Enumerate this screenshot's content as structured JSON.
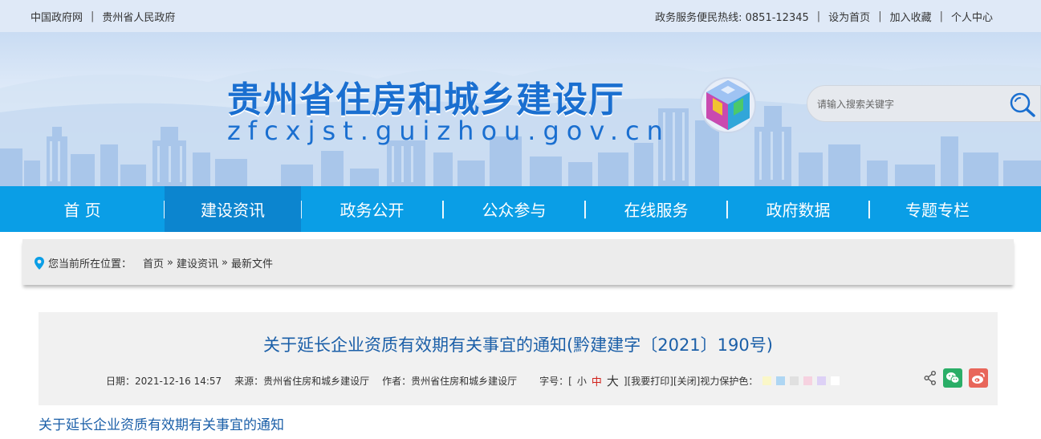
{
  "topbar": {
    "left_links": [
      "中国政府网",
      "贵州省人民政府"
    ],
    "hotline": "政务服务便民热线: 0851-12345",
    "right_links": [
      "设为首页",
      "加入收藏",
      "个人中心"
    ]
  },
  "banner": {
    "title": "贵州省住房和城乡建设厅",
    "domain": "zfcxjst.guizhou.gov.cn",
    "search_placeholder": "请输入搜索关键字"
  },
  "nav": {
    "items": [
      "首 页",
      "建设资讯",
      "政务公开",
      "公众参与",
      "在线服务",
      "政府数据",
      "专题专栏"
    ],
    "active_index": 1
  },
  "breadcrumb": {
    "prefix": "您当前所在位置：",
    "items": [
      "首页",
      "建设资讯",
      "最新文件"
    ],
    "separator": "»"
  },
  "article": {
    "title": "关于延长企业资质有效期有关事宜的通知(黔建建字〔2021〕190号)",
    "date": "日期：2021-12-16 14:57",
    "source": "来源：贵州省住房和城乡建设厅",
    "author": "作者：贵州省住房和城乡建设厅",
    "font_size_label": "字号：[",
    "font_small": "小",
    "font_mid": "中",
    "font_big": "大",
    "font_close": "]",
    "print": "[我要打印]",
    "close": "[关闭]",
    "eye_label": "视力保护色：",
    "eye_colors": [
      "#faf7c8",
      "#aed6f3",
      "#e0e0e0",
      "#f6d2e0",
      "#ddd1f6",
      "#ffffff"
    ],
    "subtitle": "关于延长企业资质有效期有关事宜的通知"
  },
  "colors": {
    "nav_bg": "#0a9ee6",
    "nav_active": "#0c85cf",
    "title_blue": "#1a6fd0",
    "link_blue": "#1b5fa8",
    "accent_red": "#d1201a",
    "wechat_green": "#2aae67",
    "weibo_red": "#e8665a"
  }
}
